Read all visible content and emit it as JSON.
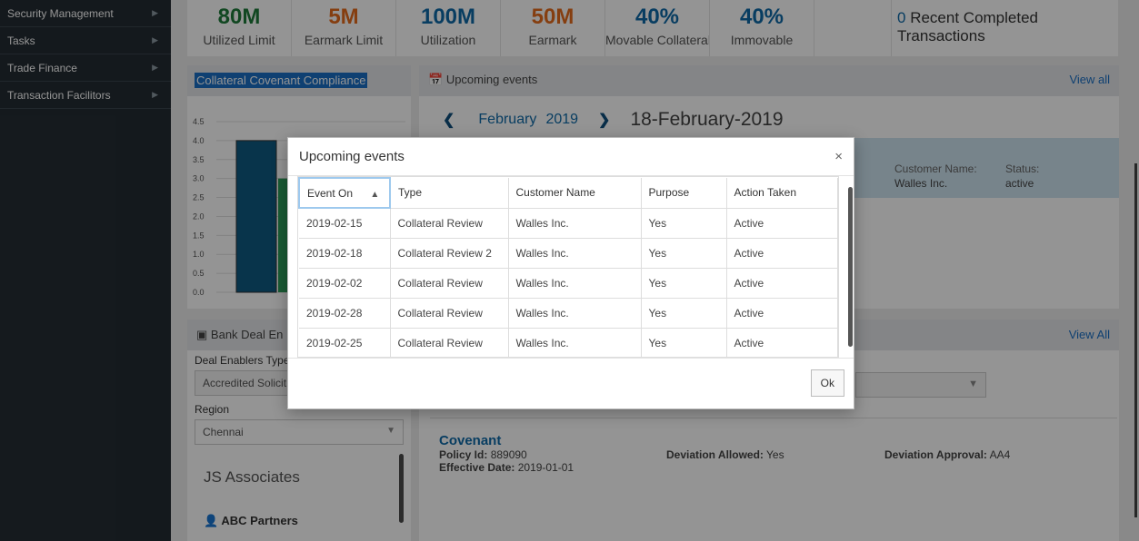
{
  "sidebar": {
    "items": [
      {
        "label": "Security Management"
      },
      {
        "label": "Tasks"
      },
      {
        "label": "Trade Finance"
      },
      {
        "label": "Transaction Facilitors"
      }
    ]
  },
  "kpis": [
    {
      "value": "80M",
      "label": "Utilized Limit",
      "color": "#1e7a3a"
    },
    {
      "value": "5M",
      "label": "Earmark Limit",
      "color": "#e66b1d"
    },
    {
      "value": "100M",
      "label": "Utilization",
      "color": "#0e6aa8"
    },
    {
      "value": "50M",
      "label": "Earmark",
      "color": "#e66b1d"
    },
    {
      "value": "40%",
      "label": "Movable Collateral",
      "color": "#0e6aa8"
    },
    {
      "value": "40%",
      "label": "Immovable",
      "color": "#0e6aa8"
    }
  ],
  "recent": {
    "count": "0",
    "text": "Recent Completed Transactions"
  },
  "collateral_panel": {
    "title": "Collateral Covenant Compliance"
  },
  "chart_data": {
    "type": "bar",
    "title": "Collateral Covenant Compliance",
    "yticks": [
      "4.5",
      "4.0",
      "3.5",
      "3.0",
      "2.5",
      "2.0",
      "1.5",
      "1.0",
      "0.5",
      "0.0"
    ],
    "ylim": [
      0,
      4.5
    ],
    "series": [
      {
        "values": [
          4.0
        ],
        "color": "#0e5b82"
      },
      {
        "values": [
          3.0
        ],
        "color": "#2e9e5b"
      }
    ]
  },
  "upcoming": {
    "title": "Upcoming events",
    "view_all": "View all",
    "month": "February",
    "year": "2019",
    "selected_date": "18-February-2019",
    "customer_label": "Customer Name:",
    "customer_value": "Walles Inc.",
    "status_label": "Status:",
    "status_value": "active"
  },
  "bank_deal": {
    "title": "Bank Deal En",
    "type_label": "Deal Enablers Type",
    "type_value": "Accredited Solicit",
    "region_label": "Region",
    "region_value": "Chennai",
    "partners": [
      "JS Associates",
      "ABC Partners"
    ]
  },
  "right_lower": {
    "view_all": "View All"
  },
  "covenant": {
    "title": "Covenant",
    "policy_label": "Policy Id:",
    "policy_value": "889090",
    "effective_label": "Effective Date:",
    "effective_value": "2019-01-01",
    "deviation_label": "Deviation Allowed:",
    "deviation_value": "Yes",
    "approval_label": "Deviation Approval:",
    "approval_value": "AA4"
  },
  "modal": {
    "title": "Upcoming events",
    "close": "×",
    "ok_label": "Ok",
    "columns": [
      "Event On",
      "Type",
      "Customer Name",
      "Purpose",
      "Action Taken"
    ],
    "rows": [
      [
        "2019-02-15",
        "Collateral Review",
        "Walles Inc.",
        "Yes",
        "Active"
      ],
      [
        "2019-02-18",
        "Collateral Review 2",
        "Walles Inc.",
        "Yes",
        "Active"
      ],
      [
        "2019-02-02",
        "Collateral Review",
        "Walles Inc.",
        "Yes",
        "Active"
      ],
      [
        "2019-02-28",
        "Collateral Review",
        "Walles Inc.",
        "Yes",
        "Active"
      ],
      [
        "2019-02-25",
        "Collateral Review",
        "Walles Inc.",
        "Yes",
        "Active"
      ]
    ]
  }
}
